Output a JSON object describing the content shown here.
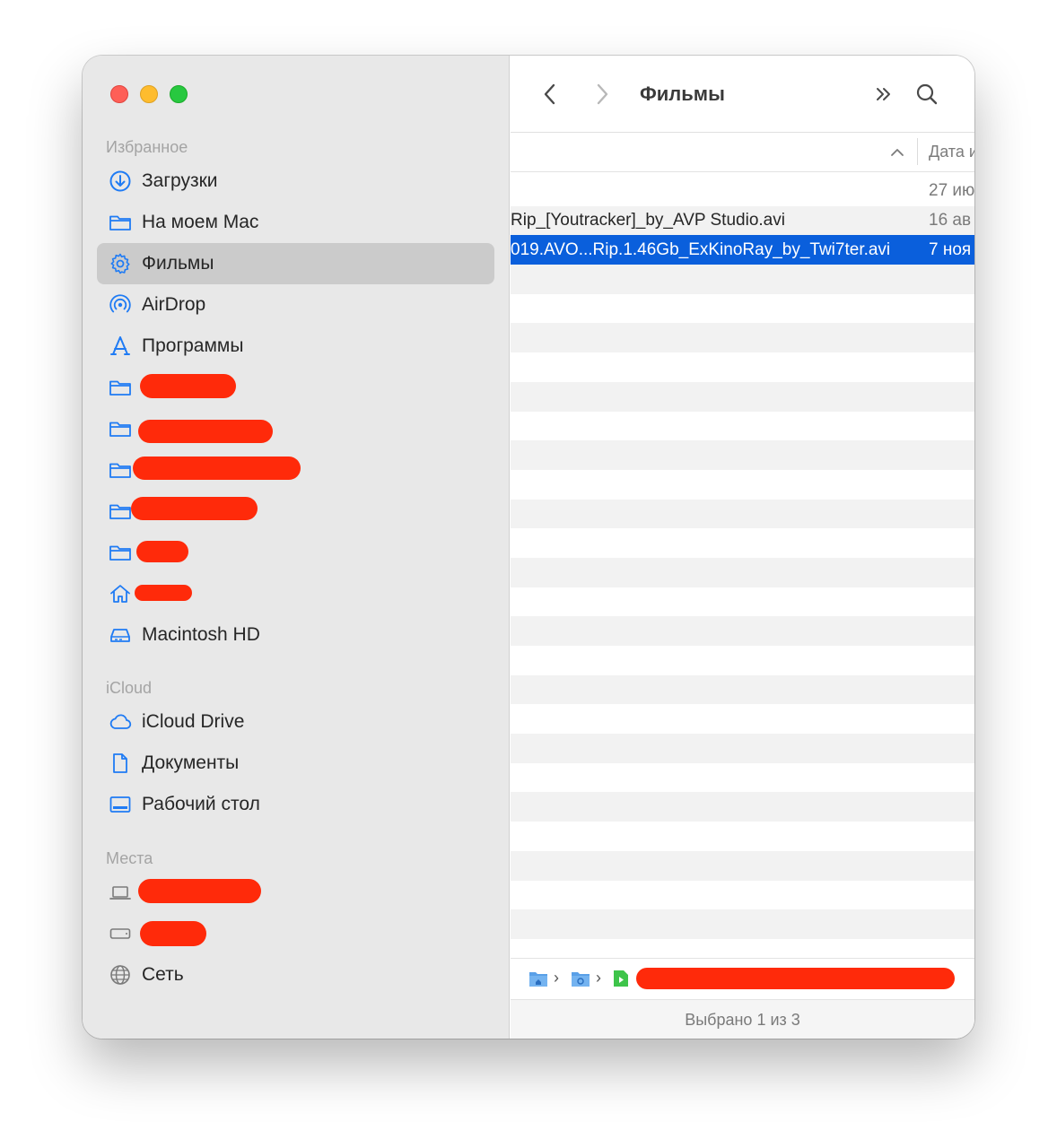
{
  "window": {
    "title": "Фильмы"
  },
  "sidebar": {
    "favorites_title": "Избранное",
    "favorites": [
      {
        "label": "Загрузки",
        "icon": "download-icon"
      },
      {
        "label": "На моем Mac",
        "icon": "folder-icon"
      },
      {
        "label": "Фильмы",
        "icon": "gear-icon",
        "selected": true
      },
      {
        "label": "AirDrop",
        "icon": "airdrop-icon"
      },
      {
        "label": "Программы",
        "icon": "applications-icon"
      },
      {
        "label": "",
        "icon": "folder-icon",
        "redacted": true
      },
      {
        "label": "",
        "icon": "folder-icon",
        "redacted": true
      },
      {
        "label": "",
        "icon": "folder-icon",
        "redacted": true
      },
      {
        "label": "",
        "icon": "folder-icon",
        "redacted": true
      },
      {
        "label": "",
        "icon": "folder-icon",
        "redacted": true
      },
      {
        "label": "",
        "icon": "home-icon",
        "redacted": true
      },
      {
        "label": "Macintosh HD",
        "icon": "disk-icon"
      }
    ],
    "icloud_title": "iCloud",
    "icloud": [
      {
        "label": "iCloud Drive",
        "icon": "cloud-icon"
      },
      {
        "label": "Документы",
        "icon": "document-icon"
      },
      {
        "label": "Рабочий стол",
        "icon": "desktop-icon"
      }
    ],
    "locations_title": "Места",
    "locations": [
      {
        "label": "",
        "icon": "laptop-icon",
        "redacted": true
      },
      {
        "label": "",
        "icon": "external-drive-icon",
        "redacted": true
      },
      {
        "label": "Сеть",
        "icon": "network-globe-icon"
      }
    ]
  },
  "toolbar": {
    "back_icon": "chevron-left-icon",
    "forward_icon": "chevron-right-icon",
    "more_icon": "double-chevron-icon",
    "search_icon": "search-icon"
  },
  "list": {
    "date_column_label": "Дата и",
    "rows": [
      {
        "name": "",
        "date": "27 ию"
      },
      {
        "name": "Rip_[Youtracker]_by_AVP Studio.avi",
        "date": "16 ав"
      },
      {
        "name": "019.AVO...Rip.1.46Gb_ExKinoRay_by_Twi7ter.avi",
        "date": "7 ноя",
        "selected": true
      }
    ],
    "empty_rows": 23
  },
  "pathbar": {
    "items": [
      {
        "icon": "home-folder-icon"
      },
      {
        "icon": "gear-folder-icon"
      },
      {
        "icon": "video-file-icon",
        "redacted": true
      }
    ]
  },
  "status": {
    "text": "Выбрано 1 из 3"
  },
  "colors": {
    "selection": "#0a5fdc",
    "accent_icon": "#1f7bf4",
    "redaction": "#ff2a0a"
  }
}
